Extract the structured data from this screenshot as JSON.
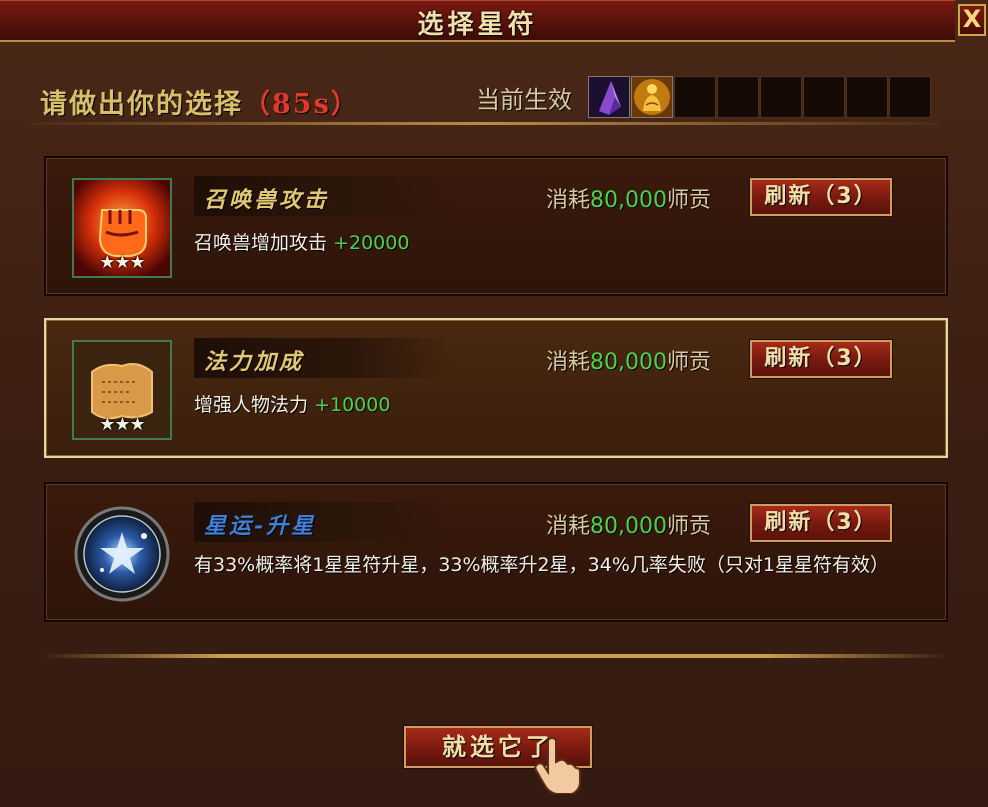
{
  "window": {
    "title": "选择星符",
    "close_label": "X"
  },
  "header": {
    "prompt_text": "请做出你的选择",
    "timer_text": "（85s）",
    "active_label": "当前生效"
  },
  "active_slots": [
    {
      "filled": true,
      "icon": "purple-crystal-icon"
    },
    {
      "filled": true,
      "icon": "golden-buddha-icon"
    },
    {
      "filled": false
    },
    {
      "filled": false
    },
    {
      "filled": false
    },
    {
      "filled": false
    },
    {
      "filled": false
    },
    {
      "filled": false
    }
  ],
  "options": [
    {
      "name": "召唤兽攻击",
      "stars": "★★★",
      "desc": "召唤兽增加攻击",
      "bonus": "+20000",
      "cost_label": "消耗",
      "cost_amount": "80,000",
      "cost_unit": "师贡",
      "refresh_label": "刷新（3）",
      "icon": "red-fist-icon",
      "selected": false
    },
    {
      "name": "法力加成",
      "stars": "★★★",
      "desc": "增强人物法力",
      "bonus": "+10000",
      "cost_label": "消耗",
      "cost_amount": "80,000",
      "cost_unit": "师贡",
      "refresh_label": "刷新（3）",
      "icon": "scroll-icon",
      "selected": true
    },
    {
      "name": "星运-升星",
      "desc": "有33%概率将1星星符升星，33%概率升2星，34%几率失败（只对1星星符有效）",
      "cost_label": "消耗",
      "cost_amount": "80,000",
      "cost_unit": "师贡",
      "refresh_label": "刷新（3）",
      "icon": "star-orb-icon",
      "selected": false
    }
  ],
  "footer": {
    "confirm_label": "就选它了"
  },
  "colors": {
    "accent_gold": "#e2c872",
    "bonus_green": "#4cd24a",
    "timer_red": "#e23a2a",
    "button_red": "#7a1a10"
  }
}
